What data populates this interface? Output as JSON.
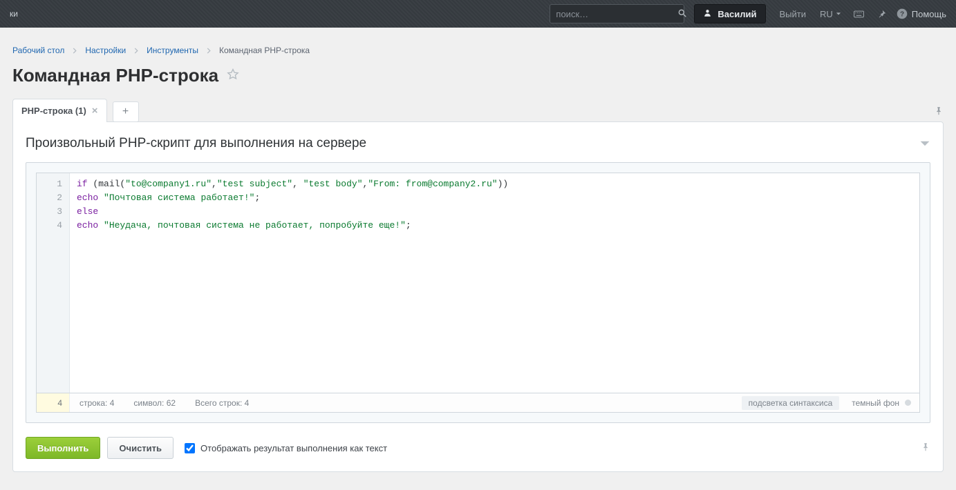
{
  "topbar": {
    "left_truncated": "ки",
    "search_placeholder": "поиск…",
    "user_name": "Василий",
    "logout": "Выйти",
    "lang": "RU",
    "help": "Помощь"
  },
  "breadcrumbs": [
    {
      "label": "Рабочий стол",
      "current": false
    },
    {
      "label": "Настройки",
      "current": false
    },
    {
      "label": "Инструменты",
      "current": false
    },
    {
      "label": "Командная PHP-строка",
      "current": true
    }
  ],
  "page_title": "Командная PHP-строка",
  "tabs": {
    "main_label": "PHP-строка (1)"
  },
  "panel": {
    "title": "Произвольный PHP-скрипт для выполнения на сервере"
  },
  "code": {
    "line1": {
      "if": "if",
      "open": " (mail(",
      "s1": "\"to@company1.ru\"",
      "c1": ",",
      "s2": "\"test subject\"",
      "c2": ", ",
      "s3": "\"test body\"",
      "c3": ",",
      "s4": "\"From: from@company2.ru\"",
      "close": "))"
    },
    "line2": {
      "echo": "echo ",
      "s": "\"Почтовая система работает!\"",
      "semi": ";"
    },
    "line3": {
      "else": "else"
    },
    "line4": {
      "echo": "echo ",
      "s": "\"Неудача, почтовая система не работает, попробуйте еще!\"",
      "semi": ";"
    }
  },
  "gutter": {
    "l1": "1",
    "l2": "2",
    "l3": "3",
    "l4": "4"
  },
  "statusbar": {
    "left_num": "4",
    "row_label": "строка:",
    "row_val": "4",
    "col_label": "символ:",
    "col_val": "62",
    "total_label": "Всего строк:",
    "total_val": "4",
    "syntax": "подсветка синтаксиса",
    "dark": "темный фон"
  },
  "actions": {
    "run": "Выполнить",
    "clear": "Очистить",
    "as_text": "Отображать результат выполнения как текст"
  }
}
